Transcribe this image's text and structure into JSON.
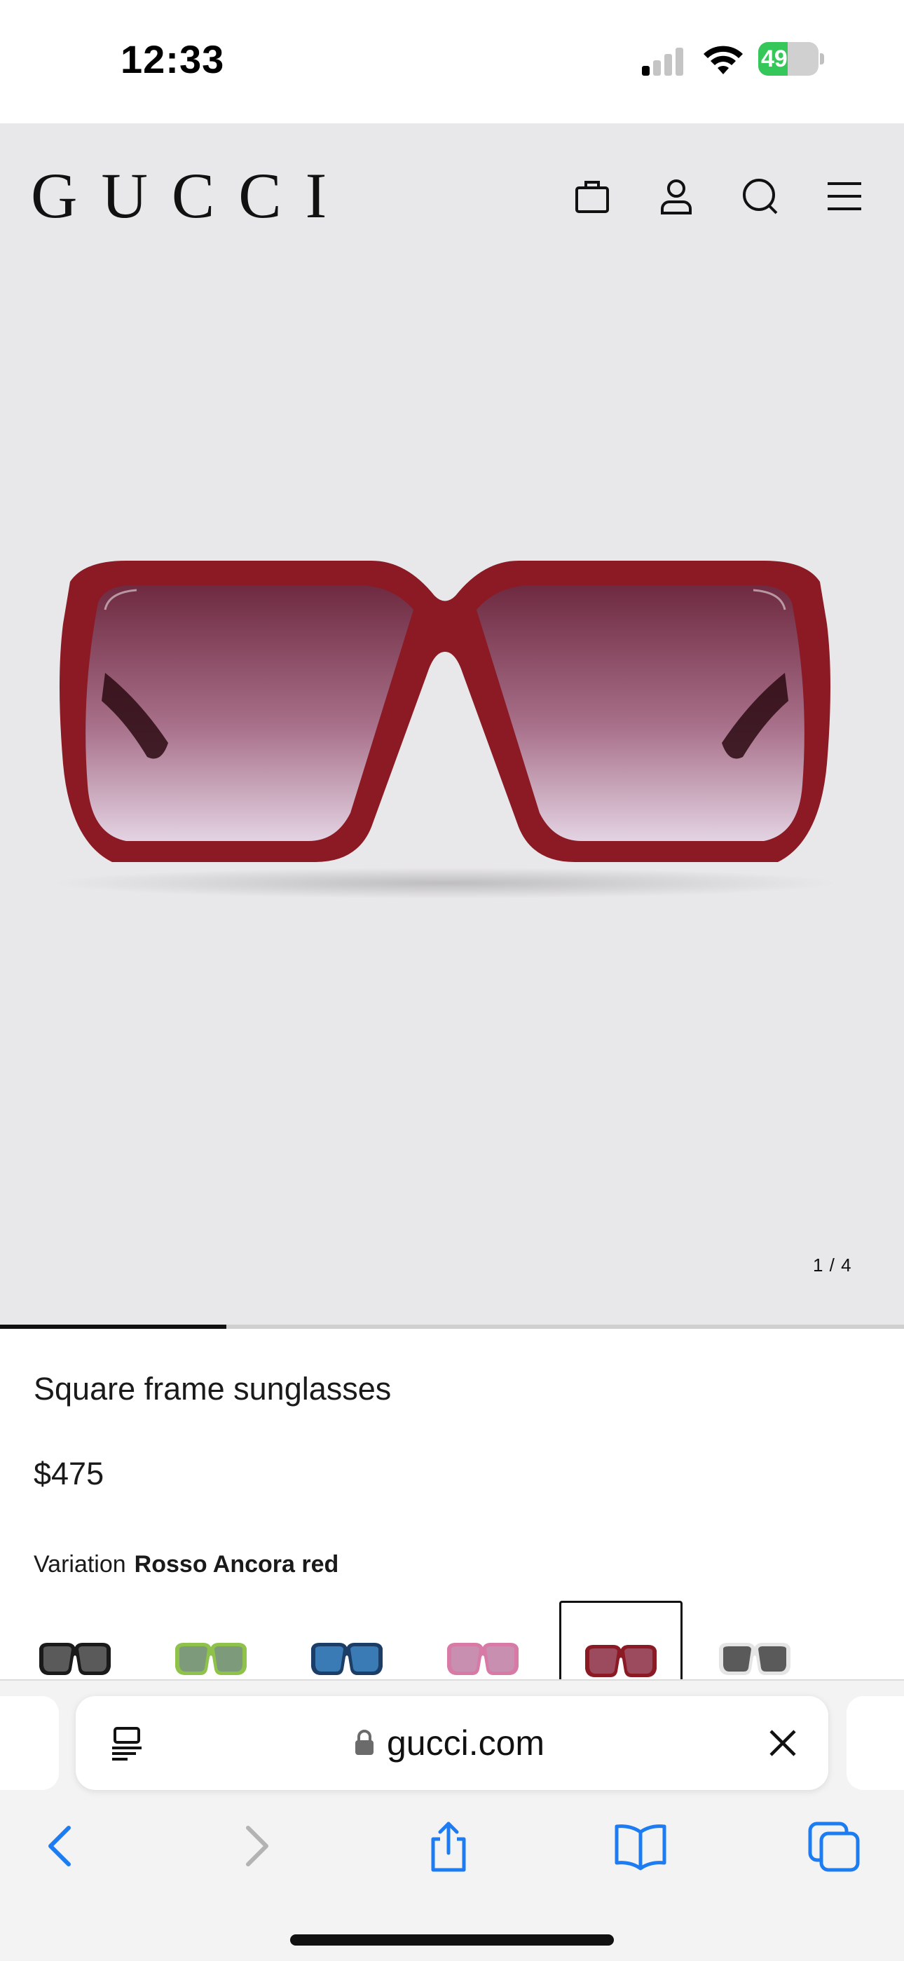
{
  "status_bar": {
    "time": "12:33",
    "battery_level": "49",
    "battery_fraction": 0.49,
    "signal_bars_active": 1,
    "signal_bars_total": 4
  },
  "header": {
    "brand": "GUCCI",
    "icons": [
      "shopping-bag-icon",
      "account-icon",
      "search-icon",
      "menu-icon"
    ]
  },
  "gallery": {
    "counter": "1 / 4",
    "progress_fraction": 0.25,
    "frame_color": "#8b1a24"
  },
  "product": {
    "name": "Square frame sunglasses",
    "price": "$475",
    "variation_label": "Variation",
    "variation_value": "Rosso Ancora red",
    "swatches": [
      {
        "name": "black",
        "color": "#1a1a1a",
        "lens": "#5a5a5a"
      },
      {
        "name": "green",
        "color": "#8fc24a",
        "lens": "#7d9a7a"
      },
      {
        "name": "blue",
        "color": "#1c3e66",
        "lens": "#3b7bb5"
      },
      {
        "name": "pink",
        "color": "#d77aa5",
        "lens": "#c98fb0"
      },
      {
        "name": "red",
        "color": "#8b1a24",
        "lens": "#9c4a5e",
        "selected": true
      },
      {
        "name": "white",
        "color": "#e5e5e5",
        "lens": "#5a5a5a"
      }
    ]
  },
  "browser": {
    "url": "gucci.com",
    "accent_color": "#1e7cf2",
    "nav": [
      "back-icon",
      "forward-icon",
      "share-icon",
      "bookmarks-icon",
      "tabs-icon"
    ]
  }
}
